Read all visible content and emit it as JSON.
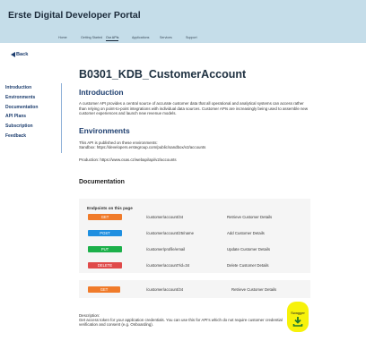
{
  "header": {
    "brand": "Erste Digital Developer Portal",
    "nav": [
      {
        "label": "Home"
      },
      {
        "label": "Getting Started"
      },
      {
        "label": "Our APIs"
      },
      {
        "label": "Applications"
      },
      {
        "label": "Services"
      },
      {
        "label": "Support"
      }
    ]
  },
  "back_label": "Back",
  "sidebar": {
    "items": [
      {
        "label": "Introduction"
      },
      {
        "label": "Environments"
      },
      {
        "label": "Documentation"
      },
      {
        "label": "API Plans"
      },
      {
        "label": "Subscription"
      },
      {
        "label": "Feedback"
      }
    ]
  },
  "page_title": "B0301_KDB_CustomerAccount",
  "introduction": {
    "heading": "Introduction",
    "text": "A customer API provides a central source of accurate customer data that all operational and analytical systems can access rather than relying on point-to-point integrations with individual data sources. Customer APIs are increasingly being used to assemble new customer experiences and launch new revenue models."
  },
  "environments": {
    "heading": "Environments",
    "line1": "This API is published on these environments:",
    "line2": "Sandbox: https://developers.erstegroup.com/public/sandbox/v2/accounts",
    "line3": "Production: https://www.csas.cz/webapi/api/v2/accounts"
  },
  "documentation": {
    "heading": "Documentation",
    "endpoints_title": "Endpoints on this page",
    "endpoints": [
      {
        "method": "GET",
        "path": "/customer/account/34",
        "desc": "Retrieve Customer Details",
        "color": "#f07b2a"
      },
      {
        "method": "POST",
        "path": "/customer/account/25/name",
        "desc": "Add Customer Details",
        "color": "#1f8fe0"
      },
      {
        "method": "PUT",
        "path": "/customer/profile/email",
        "desc": "Update Customer Details",
        "color": "#1cb04a"
      },
      {
        "method": "DELETE",
        "path": "/customer/account?id=34",
        "desc": "Delete Customer Details",
        "color": "#e04a4a"
      }
    ],
    "selected": {
      "method": "GET",
      "path": "/customer/account/34",
      "desc": "Retrieve Customer Details",
      "color": "#f07b2a"
    },
    "description_label": "Description:",
    "description_text": "Get access token for your application credentials. You can use this for API's which do not require customer credential verification and consent (e.g. Onboarding)."
  },
  "swagger_label": "Swagger",
  "colors": {
    "header_bg": "#c5dde9",
    "accent": "#1c3d6e",
    "highlight": "#f7f20a"
  }
}
